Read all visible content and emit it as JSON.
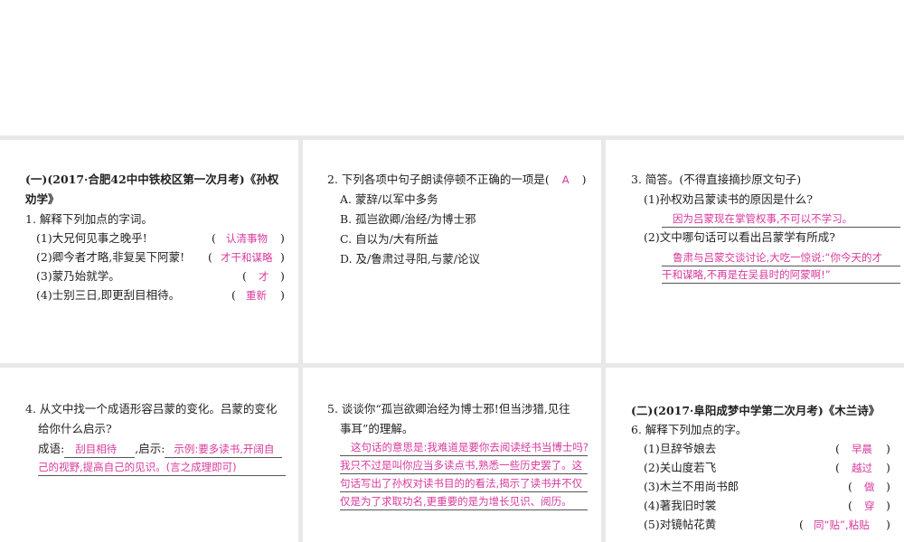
{
  "p1": {
    "head": "(一)(2017·合肥42中中铁校区第一次月考)《孙权",
    "head2": "劝学》",
    "q": "1. 解释下列加点的字词。",
    "items": [
      {
        "t": "(1)大兄何见事之晚乎!",
        "a": "认清事物"
      },
      {
        "t": "(2)卿今者才略,非复吴下阿蒙!",
        "a": "才干和谋略"
      },
      {
        "t": "(3)蒙乃始就学。",
        "a": "才"
      },
      {
        "t": "(4)士别三日,即更刮目相待。",
        "a": "重新"
      }
    ]
  },
  "p2": {
    "q": "2. 下列各项中句子朗读停顿不正确的一项是(",
    "a": "A",
    "close": ")",
    "opts": [
      "A. 蒙辞/以军中多务",
      "B. 孤岂欲卿/治经/为博士邪",
      "C. 自以为/大有所益",
      "D. 及/鲁肃过寻阳,与蒙/论议"
    ]
  },
  "p3": {
    "q": "3. 简答。(不得直接摘抄原文句子)",
    "s1": "(1)孙权劝吕蒙读书的原因是什么?",
    "a1": "因为吕蒙现在掌管权事,不可以不学习。",
    "s2": "(2)文中哪句话可以看出吕蒙学有所成?",
    "a2a": "鲁肃与吕蒙交谈讨论,大吃一惊说:“你今天的才",
    "a2b": "干和谋略,不再是在吴县时的阿蒙啊!”"
  },
  "p4": {
    "q": "4. 从文中找一个成语形容吕蒙的变化。吕蒙的变化",
    "q2": "给你什么启示?",
    "l1": "成语:",
    "a1": "刮目相待",
    "l2": ",启示:",
    "a2a": "示例:要多读书,开阔自",
    "a2b": "己的视野,提高自己的见识。(言之成理即可)"
  },
  "p5": {
    "q": "5. 谈谈你“孤岂欲卿治经为博士邪!但当涉猎,见往",
    "q2": "事耳”的理解。",
    "a": [
      "这句话的意思是:我难道是要你去阅读经书当博士吗?",
      "我只不过是叫你应当多读点书,熟悉一些历史罢了。这",
      "句话写出了孙权对读书目的的看法,揭示了读书并不仅",
      "仅是为了求取功名,更重要的是为增长见识、阅历。"
    ]
  },
  "p6": {
    "head": "(二)(2017·阜阳成梦中学第二次月考)《木兰诗》",
    "q": "6. 解释下列加点的字。",
    "items": [
      {
        "t": "(1)旦辞爷娘去",
        "a": "早晨"
      },
      {
        "t": "(2)关山度若飞",
        "a": "越过"
      },
      {
        "t": "(3)木兰不用尚书郎",
        "a": "做"
      },
      {
        "t": "(4)著我旧时裳",
        "a": "穿"
      },
      {
        "t": "(5)对镜帖花黄",
        "a": "同“贴”,粘贴"
      }
    ]
  }
}
